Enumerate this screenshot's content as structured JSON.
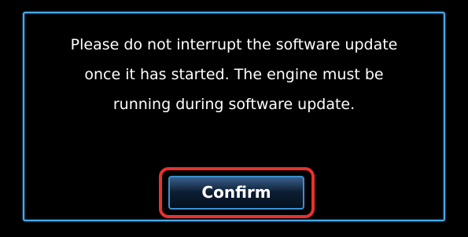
{
  "dialog": {
    "message_lines": [
      "Please do not interrupt the software update",
      "once it has started. The engine must be",
      "running during software update."
    ],
    "confirm_label": "Confirm"
  },
  "colors": {
    "background": "#000000",
    "dialog_border": "#4aa8e8",
    "text": "#ffffff",
    "highlight_outline": "#e8312f",
    "button_top": "#3a5f8c",
    "button_bottom": "#04101f"
  }
}
